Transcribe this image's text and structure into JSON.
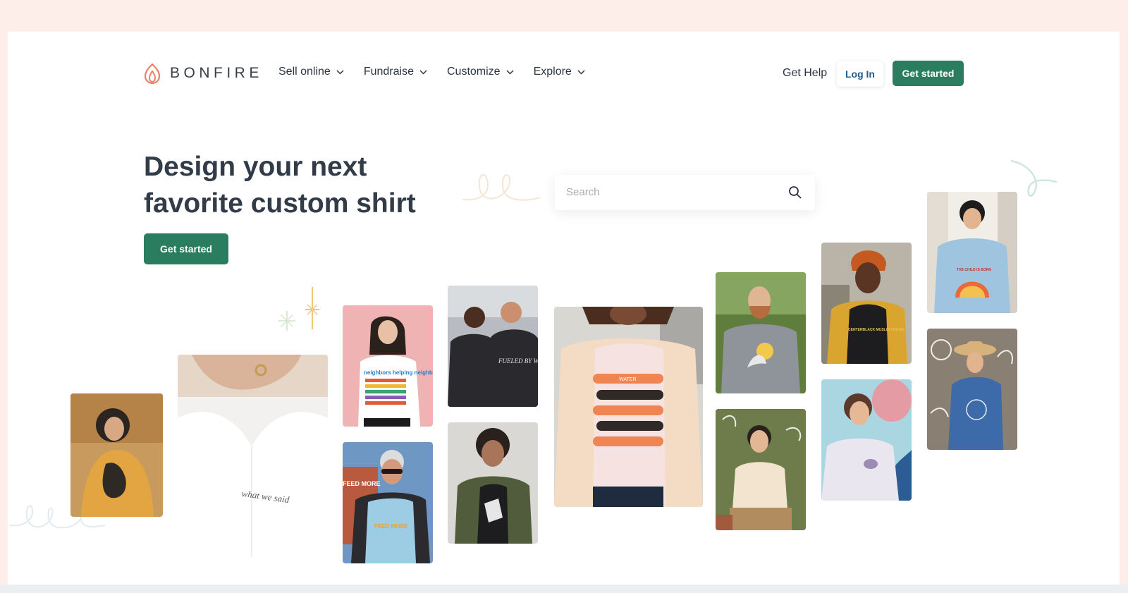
{
  "header": {
    "brand": "BONFIRE",
    "nav": [
      {
        "label": "Sell online"
      },
      {
        "label": "Fundraise"
      },
      {
        "label": "Customize"
      },
      {
        "label": "Explore"
      }
    ],
    "get_help": "Get Help",
    "login": "Log In",
    "cta": "Get started"
  },
  "hero": {
    "title_line1": "Design your next",
    "title_line2": "favorite custom shirt",
    "cta": "Get started"
  },
  "search": {
    "placeholder": "Search"
  },
  "colors": {
    "brand_green": "#2a7d5f",
    "login_text": "#205c8a",
    "logo_orange": "#e8826a",
    "page_frame": "#fdeee9"
  },
  "photos": {
    "hoodie_text": "what we said",
    "neighbors_shirt": "neighbors helping neighbors",
    "fueled_shirt": "FUELED BY WATER",
    "feed_more": "FEED MORE",
    "feed_more_shirt": "FEED MORE",
    "water_shirt": "WATER",
    "centerblack_shirt": "CENTERBLACK MUSLIM VOICES",
    "kid_shirt": "THE CHILD IS BORN"
  }
}
